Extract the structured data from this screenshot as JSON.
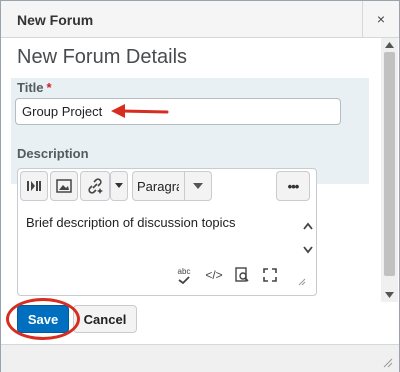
{
  "dialog": {
    "title": "New Forum",
    "close_glyph": "×"
  },
  "form": {
    "heading": "New Forum Details",
    "title_label": "Title",
    "required_mark": "*",
    "title_value": "Group Project",
    "description_label": "Description",
    "description_text": "Brief description of discussion topics",
    "format_value": "Paragraph"
  },
  "toolbar": {
    "icons": [
      "insert-stuff-icon",
      "insert-image-icon",
      "insert-link-icon",
      "chevron-down-icon",
      "more-options-icon"
    ],
    "more_label": "•••"
  },
  "editor_footer": {
    "spellcheck_label": "abc",
    "source_label": "</>"
  },
  "actions": {
    "save_label": "Save",
    "cancel_label": "Cancel"
  },
  "annotations": {
    "arrow_color": "#d62d20",
    "circle_color": "#d62d20"
  },
  "colors": {
    "primary": "#006fbf",
    "title_section_bg": "#e8f0f3"
  }
}
